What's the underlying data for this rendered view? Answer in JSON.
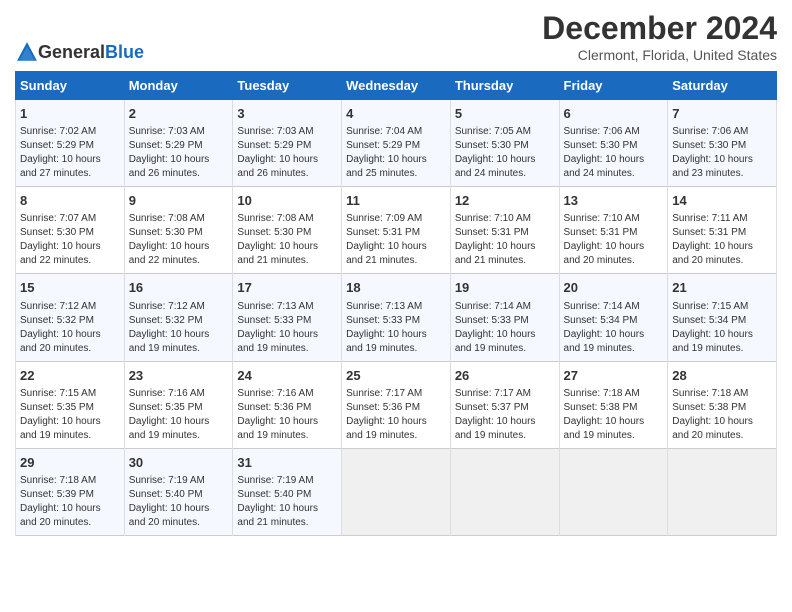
{
  "logo": {
    "general": "General",
    "blue": "Blue"
  },
  "title": "December 2024",
  "location": "Clermont, Florida, United States",
  "days_header": [
    "Sunday",
    "Monday",
    "Tuesday",
    "Wednesday",
    "Thursday",
    "Friday",
    "Saturday"
  ],
  "weeks": [
    [
      {
        "day": "1",
        "sunrise": "Sunrise: 7:02 AM",
        "sunset": "Sunset: 5:29 PM",
        "daylight": "Daylight: 10 hours and 27 minutes."
      },
      {
        "day": "2",
        "sunrise": "Sunrise: 7:03 AM",
        "sunset": "Sunset: 5:29 PM",
        "daylight": "Daylight: 10 hours and 26 minutes."
      },
      {
        "day": "3",
        "sunrise": "Sunrise: 7:03 AM",
        "sunset": "Sunset: 5:29 PM",
        "daylight": "Daylight: 10 hours and 26 minutes."
      },
      {
        "day": "4",
        "sunrise": "Sunrise: 7:04 AM",
        "sunset": "Sunset: 5:29 PM",
        "daylight": "Daylight: 10 hours and 25 minutes."
      },
      {
        "day": "5",
        "sunrise": "Sunrise: 7:05 AM",
        "sunset": "Sunset: 5:30 PM",
        "daylight": "Daylight: 10 hours and 24 minutes."
      },
      {
        "day": "6",
        "sunrise": "Sunrise: 7:06 AM",
        "sunset": "Sunset: 5:30 PM",
        "daylight": "Daylight: 10 hours and 24 minutes."
      },
      {
        "day": "7",
        "sunrise": "Sunrise: 7:06 AM",
        "sunset": "Sunset: 5:30 PM",
        "daylight": "Daylight: 10 hours and 23 minutes."
      }
    ],
    [
      {
        "day": "8",
        "sunrise": "Sunrise: 7:07 AM",
        "sunset": "Sunset: 5:30 PM",
        "daylight": "Daylight: 10 hours and 22 minutes."
      },
      {
        "day": "9",
        "sunrise": "Sunrise: 7:08 AM",
        "sunset": "Sunset: 5:30 PM",
        "daylight": "Daylight: 10 hours and 22 minutes."
      },
      {
        "day": "10",
        "sunrise": "Sunrise: 7:08 AM",
        "sunset": "Sunset: 5:30 PM",
        "daylight": "Daylight: 10 hours and 21 minutes."
      },
      {
        "day": "11",
        "sunrise": "Sunrise: 7:09 AM",
        "sunset": "Sunset: 5:31 PM",
        "daylight": "Daylight: 10 hours and 21 minutes."
      },
      {
        "day": "12",
        "sunrise": "Sunrise: 7:10 AM",
        "sunset": "Sunset: 5:31 PM",
        "daylight": "Daylight: 10 hours and 21 minutes."
      },
      {
        "day": "13",
        "sunrise": "Sunrise: 7:10 AM",
        "sunset": "Sunset: 5:31 PM",
        "daylight": "Daylight: 10 hours and 20 minutes."
      },
      {
        "day": "14",
        "sunrise": "Sunrise: 7:11 AM",
        "sunset": "Sunset: 5:31 PM",
        "daylight": "Daylight: 10 hours and 20 minutes."
      }
    ],
    [
      {
        "day": "15",
        "sunrise": "Sunrise: 7:12 AM",
        "sunset": "Sunset: 5:32 PM",
        "daylight": "Daylight: 10 hours and 20 minutes."
      },
      {
        "day": "16",
        "sunrise": "Sunrise: 7:12 AM",
        "sunset": "Sunset: 5:32 PM",
        "daylight": "Daylight: 10 hours and 19 minutes."
      },
      {
        "day": "17",
        "sunrise": "Sunrise: 7:13 AM",
        "sunset": "Sunset: 5:33 PM",
        "daylight": "Daylight: 10 hours and 19 minutes."
      },
      {
        "day": "18",
        "sunrise": "Sunrise: 7:13 AM",
        "sunset": "Sunset: 5:33 PM",
        "daylight": "Daylight: 10 hours and 19 minutes."
      },
      {
        "day": "19",
        "sunrise": "Sunrise: 7:14 AM",
        "sunset": "Sunset: 5:33 PM",
        "daylight": "Daylight: 10 hours and 19 minutes."
      },
      {
        "day": "20",
        "sunrise": "Sunrise: 7:14 AM",
        "sunset": "Sunset: 5:34 PM",
        "daylight": "Daylight: 10 hours and 19 minutes."
      },
      {
        "day": "21",
        "sunrise": "Sunrise: 7:15 AM",
        "sunset": "Sunset: 5:34 PM",
        "daylight": "Daylight: 10 hours and 19 minutes."
      }
    ],
    [
      {
        "day": "22",
        "sunrise": "Sunrise: 7:15 AM",
        "sunset": "Sunset: 5:35 PM",
        "daylight": "Daylight: 10 hours and 19 minutes."
      },
      {
        "day": "23",
        "sunrise": "Sunrise: 7:16 AM",
        "sunset": "Sunset: 5:35 PM",
        "daylight": "Daylight: 10 hours and 19 minutes."
      },
      {
        "day": "24",
        "sunrise": "Sunrise: 7:16 AM",
        "sunset": "Sunset: 5:36 PM",
        "daylight": "Daylight: 10 hours and 19 minutes."
      },
      {
        "day": "25",
        "sunrise": "Sunrise: 7:17 AM",
        "sunset": "Sunset: 5:36 PM",
        "daylight": "Daylight: 10 hours and 19 minutes."
      },
      {
        "day": "26",
        "sunrise": "Sunrise: 7:17 AM",
        "sunset": "Sunset: 5:37 PM",
        "daylight": "Daylight: 10 hours and 19 minutes."
      },
      {
        "day": "27",
        "sunrise": "Sunrise: 7:18 AM",
        "sunset": "Sunset: 5:38 PM",
        "daylight": "Daylight: 10 hours and 19 minutes."
      },
      {
        "day": "28",
        "sunrise": "Sunrise: 7:18 AM",
        "sunset": "Sunset: 5:38 PM",
        "daylight": "Daylight: 10 hours and 20 minutes."
      }
    ],
    [
      {
        "day": "29",
        "sunrise": "Sunrise: 7:18 AM",
        "sunset": "Sunset: 5:39 PM",
        "daylight": "Daylight: 10 hours and 20 minutes."
      },
      {
        "day": "30",
        "sunrise": "Sunrise: 7:19 AM",
        "sunset": "Sunset: 5:40 PM",
        "daylight": "Daylight: 10 hours and 20 minutes."
      },
      {
        "day": "31",
        "sunrise": "Sunrise: 7:19 AM",
        "sunset": "Sunset: 5:40 PM",
        "daylight": "Daylight: 10 hours and 21 minutes."
      },
      null,
      null,
      null,
      null
    ]
  ]
}
